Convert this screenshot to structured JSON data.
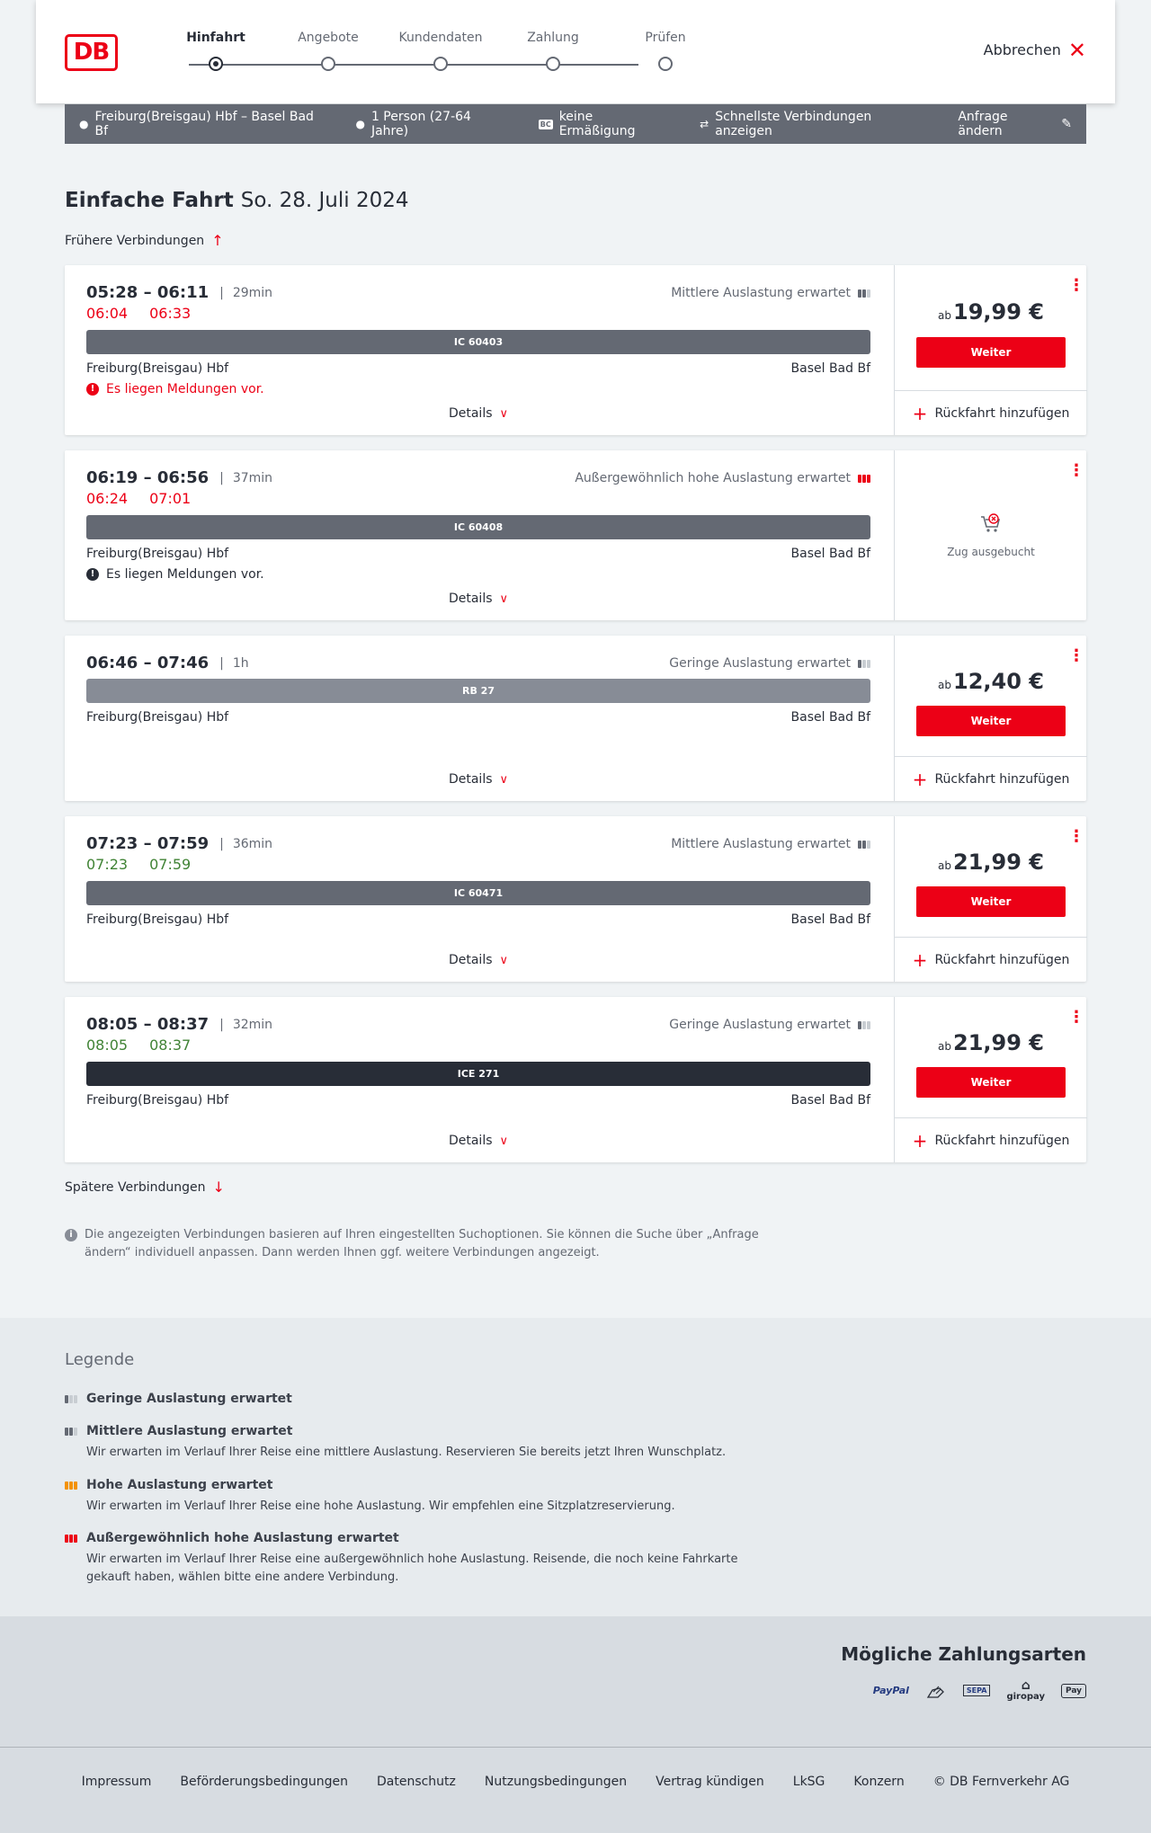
{
  "header": {
    "logo": "DB",
    "steps": [
      {
        "label": "Hinfahrt",
        "active": true
      },
      {
        "label": "Angebote",
        "active": false
      },
      {
        "label": "Kundendaten",
        "active": false
      },
      {
        "label": "Zahlung",
        "active": false
      },
      {
        "label": "Prüfen",
        "active": false
      }
    ],
    "cancel_label": "Abbrechen"
  },
  "summary": {
    "route": "Freiburg(Breisgau) Hbf – Basel Bad Bf",
    "passengers": "1 Person (27-64 Jahre)",
    "discount_badge": "BC",
    "discount": "keine Ermäßigung",
    "fastest": "Schnellste Verbindungen anzeigen",
    "edit_label": "Anfrage ändern"
  },
  "page": {
    "title": "Einfache Fahrt",
    "date": "So. 28. Juli 2024",
    "earlier": "Frühere Verbindungen",
    "later": "Spätere Verbindungen",
    "info": "Die angezeigten Verbindungen basieren auf Ihren eingestellten Suchoptionen. Sie können die Suche über „Anfrage ändern“ individuell anpassen. Dann werden Ihnen ggf. weitere Verbindungen angezeigt."
  },
  "connections": [
    {
      "times": "05:28 – 06:11",
      "duration": "29min",
      "rt_dep": "06:04",
      "rt_arr": "06:33",
      "load": "Mittlere Auslastung erwartet",
      "train": "IC 60403",
      "from": "Freiburg(Breisgau) Hbf",
      "to": "Basel Bad Bf",
      "notice": "Es liegen Meldungen vor.",
      "details": "Details",
      "price_prefix": "ab",
      "price": "19,99 €",
      "button": "Weiter",
      "return": "Rückfahrt hinzufügen"
    },
    {
      "times": "06:19 – 06:56",
      "duration": "37min",
      "rt_dep": "06:24",
      "rt_arr": "07:01",
      "load": "Außergewöhnlich hohe Auslastung erwartet",
      "train": "IC 60408",
      "from": "Freiburg(Breisgau) Hbf",
      "to": "Basel Bad Bf",
      "notice": "Es liegen Meldungen vor.",
      "details": "Details",
      "soldout": "Zug ausgebucht"
    },
    {
      "times": "06:46 – 07:46",
      "duration": "1h",
      "load": "Geringe Auslastung erwartet",
      "train": "RB 27",
      "from": "Freiburg(Breisgau) Hbf",
      "to": "Basel Bad Bf",
      "details": "Details",
      "price_prefix": "ab",
      "price": "12,40 €",
      "button": "Weiter",
      "return": "Rückfahrt hinzufügen"
    },
    {
      "times": "07:23 – 07:59",
      "duration": "36min",
      "rt_dep": "07:23",
      "rt_arr": "07:59",
      "load": "Mittlere Auslastung erwartet",
      "train": "IC 60471",
      "from": "Freiburg(Breisgau) Hbf",
      "to": "Basel Bad Bf",
      "details": "Details",
      "price_prefix": "ab",
      "price": "21,99 €",
      "button": "Weiter",
      "return": "Rückfahrt hinzufügen"
    },
    {
      "times": "08:05 – 08:37",
      "duration": "32min",
      "rt_dep": "08:05",
      "rt_arr": "08:37",
      "load": "Geringe Auslastung erwartet",
      "train": "ICE 271",
      "from": "Freiburg(Breisgau) Hbf",
      "to": "Basel Bad Bf",
      "details": "Details",
      "price_prefix": "ab",
      "price": "21,99 €",
      "button": "Weiter",
      "return": "Rückfahrt hinzufügen"
    }
  ],
  "legend": {
    "title": "Legende",
    "items": [
      {
        "title": "Geringe Auslastung erwartet",
        "desc": ""
      },
      {
        "title": "Mittlere Auslastung erwartet",
        "desc": "Wir erwarten im Verlauf Ihrer Reise eine mittlere Auslastung. Reservieren Sie bereits jetzt Ihren Wunschplatz."
      },
      {
        "title": "Hohe Auslastung erwartet",
        "desc": "Wir erwarten im Verlauf Ihrer Reise eine hohe Auslastung. Wir empfehlen eine Sitzplatzreservierung."
      },
      {
        "title": "Außergewöhnlich hohe Auslastung erwartet",
        "desc": "Wir erwarten im Verlauf Ihrer Reise eine außergewöhnlich hohe Auslastung. Reisende, die noch keine Fahrkarte gekauft haben, wählen bitte eine andere Verbindung."
      }
    ]
  },
  "payments": {
    "title": "Mögliche Zahlungsarten",
    "paypal": "PayPal",
    "sepa": "SEPA",
    "giropay": "giropay",
    "applepay": "Pay"
  },
  "footer": {
    "links": [
      "Impressum",
      "Beförderungsbedingungen",
      "Datenschutz",
      "Nutzungsbedingungen",
      "Vertrag kündigen",
      "LkSG",
      "Konzern",
      "© DB Fernverkehr AG"
    ]
  },
  "colors": {
    "brand_red": "#ec0016",
    "delay_red": "#ec0016",
    "ontime_green": "#408335",
    "ic_bar": "#646973",
    "rb_bar": "#878c96",
    "ice_bar": "#282d37"
  }
}
